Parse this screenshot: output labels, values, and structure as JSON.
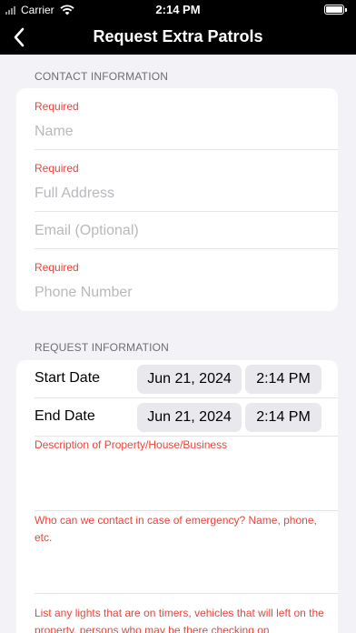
{
  "status_bar": {
    "carrier": "Carrier",
    "time": "2:14 PM"
  },
  "nav": {
    "title": "Request Extra Patrols",
    "back_icon": "chevron-left-icon"
  },
  "contact_section": {
    "header": "CONTACT INFORMATION",
    "fields": [
      {
        "required_label": "Required",
        "placeholder": "Name"
      },
      {
        "required_label": "Required",
        "placeholder": "Full Address"
      },
      {
        "required_label": "",
        "placeholder": "Email (Optional)"
      },
      {
        "required_label": "Required",
        "placeholder": "Phone Number"
      }
    ]
  },
  "request_section": {
    "header": "REQUEST INFORMATION",
    "start": {
      "label": "Start Date",
      "date": "Jun 21, 2024",
      "time": "2:14 PM"
    },
    "end": {
      "label": "End Date",
      "date": "Jun 21, 2024",
      "time": "2:14 PM"
    },
    "text_areas": [
      "Description of Property/House/Business",
      "Who can we contact in case of emergency? Name, phone, etc.",
      "List any lights that are on timers, vehicles that will left on the property, persons who may be there checking on"
    ]
  },
  "colors": {
    "required": "#e8453c",
    "placeholder": "#b8b8bd",
    "background": "#f2f2f7",
    "bar": "#000000"
  }
}
